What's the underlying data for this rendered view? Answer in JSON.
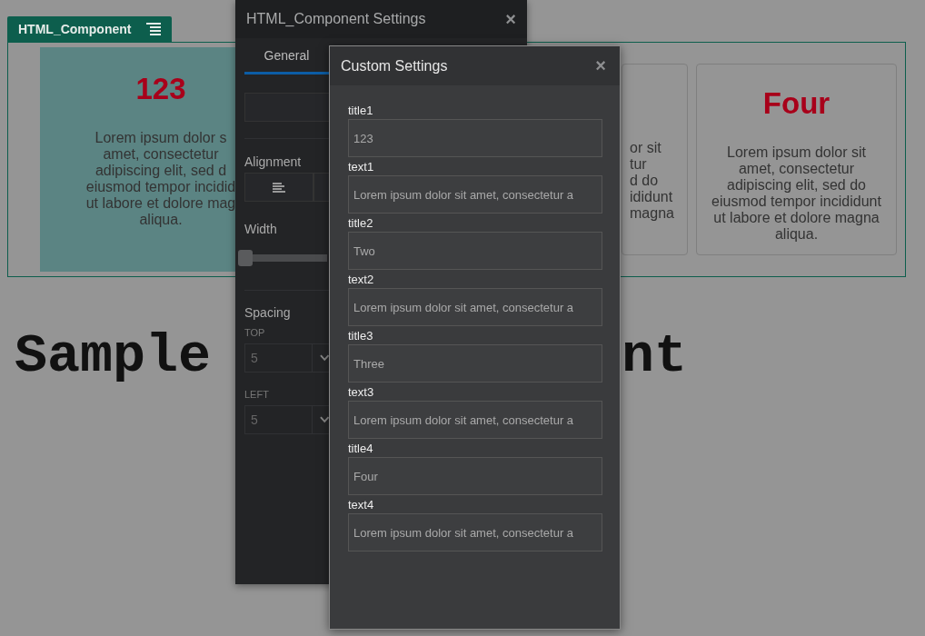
{
  "component_tab": {
    "label": "HTML_Component"
  },
  "cards": [
    {
      "kind": "full",
      "selected": true,
      "title": "123",
      "lines": [
        "Lorem ipsum dolor s",
        "amet, consectetur",
        "adipiscing elit, sed d",
        "eiusmod tempor incidid",
        "ut labore et dolore mag",
        "aliqua."
      ]
    },
    {
      "kind": "fragment",
      "selected": false,
      "lines": [
        "or sit",
        "tur",
        "d do",
        "ididunt",
        "magna"
      ]
    },
    {
      "kind": "full",
      "selected": false,
      "title": "Four",
      "lines": [
        "Lorem ipsum dolor sit",
        "amet, consectetur",
        "adipiscing elit, sed do",
        "eiusmod tempor incididunt",
        "ut labore et dolore magna",
        "aliqua."
      ]
    }
  ],
  "heading_fragments": [
    "Sample",
    "nt"
  ],
  "settings_panel": {
    "title": "HTML_Component Settings",
    "close": "×",
    "tabs": [
      {
        "label": "General",
        "selected": true
      }
    ],
    "alignment_label": "Alignment",
    "width_label": "Width",
    "width_slider": {
      "level": 0
    },
    "spacing_label": "Spacing",
    "spacing": [
      {
        "label": "TOP",
        "value": "5"
      },
      {
        "label": "LEFT",
        "value": "5"
      }
    ]
  },
  "custom_settings": {
    "title": "Custom Settings",
    "close": "×",
    "fields": [
      {
        "label": "title1",
        "value": "123"
      },
      {
        "label": "text1",
        "value": "Lorem ipsum dolor sit amet, consectetur a"
      },
      {
        "label": "title2",
        "value": "Two"
      },
      {
        "label": "text2",
        "value": "Lorem ipsum dolor sit amet, consectetur a"
      },
      {
        "label": "title3",
        "value": "Three"
      },
      {
        "label": "text3",
        "value": "Lorem ipsum dolor sit amet, consectetur a"
      },
      {
        "label": "title4",
        "value": "Four"
      },
      {
        "label": "text4",
        "value": "Lorem ipsum dolor sit amet, consectetur a"
      }
    ]
  }
}
